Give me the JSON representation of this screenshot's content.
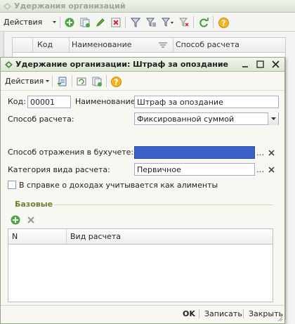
{
  "bg_window": {
    "title": "Удержания организаций",
    "actions_label": "Действия",
    "columns": [
      "Код",
      "Наименование",
      "Способ расчета"
    ]
  },
  "dialog": {
    "title": "Удержание организации: Штраф за опоздание",
    "actions_label": "Действия",
    "form": {
      "code_label": "Код:",
      "code_value": "00001",
      "name_label": "Наименование:",
      "name_value": "Штраф за опоздание",
      "calc_method_label": "Способ расчета:",
      "calc_method_value": "Фиксированной суммой",
      "accounting_label": "Способ отражения в бухучете:",
      "accounting_value": "",
      "category_label": "Категория вида расчета:",
      "category_value": "Первичное",
      "alimony_checkbox_label": "В справке о доходах учитывается как алименты",
      "alimony_checked": false
    },
    "base_section": {
      "title": "Базовые",
      "columns": [
        "N",
        "Вид расчета"
      ],
      "rows": []
    },
    "footer": {
      "ok_label": "OK",
      "save_label": "Записать",
      "close_label": "Закрыть"
    }
  },
  "colors": {
    "accent_green": "#6d7f2e",
    "selected_field": "#3b62c7",
    "title_bar": "#dbe6d4"
  }
}
